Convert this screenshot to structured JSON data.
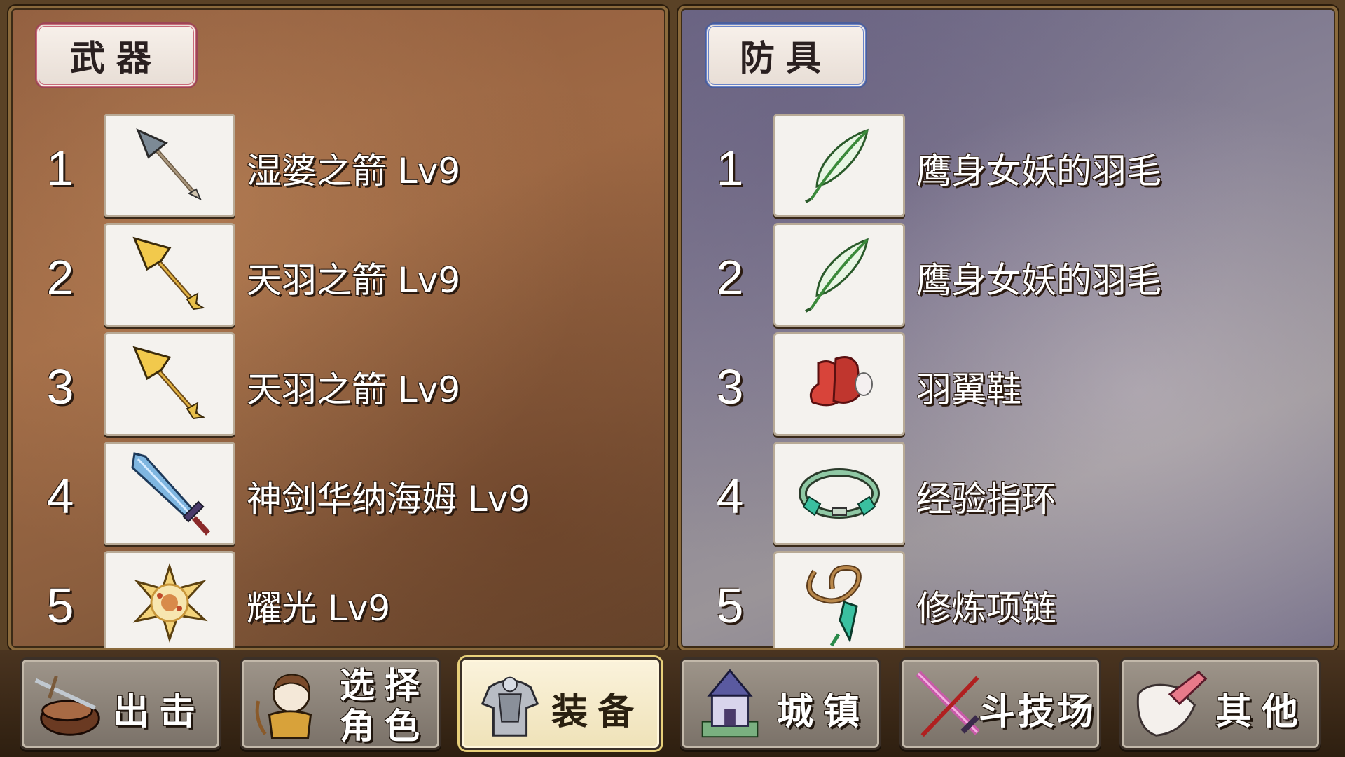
{
  "weapons": {
    "tab_label": "武器",
    "items": [
      {
        "num": "1",
        "name": "湿婆之箭 Lv9",
        "icon": "arrow-icon"
      },
      {
        "num": "2",
        "name": "天羽之箭 Lv9",
        "icon": "golden-arrow-icon"
      },
      {
        "num": "3",
        "name": "天羽之箭 Lv9",
        "icon": "golden-arrow-icon"
      },
      {
        "num": "4",
        "name": "神剑华纳海姆 Lv9",
        "icon": "sword-icon"
      },
      {
        "num": "5",
        "name": "耀光 Lv9",
        "icon": "radiant-orb-icon"
      }
    ]
  },
  "armor": {
    "tab_label": "防具",
    "items": [
      {
        "num": "1",
        "name": "鹰身女妖的羽毛",
        "icon": "feather-icon"
      },
      {
        "num": "2",
        "name": "鹰身女妖的羽毛",
        "icon": "feather-icon"
      },
      {
        "num": "3",
        "name": "羽翼鞋",
        "icon": "winged-boots-icon"
      },
      {
        "num": "4",
        "name": "经验指环",
        "icon": "ring-icon"
      },
      {
        "num": "5",
        "name": "修炼项链",
        "icon": "necklace-icon"
      }
    ]
  },
  "nav": {
    "items": [
      {
        "label": "出击",
        "icon": "war-drum-icon",
        "active": false
      },
      {
        "label_line1": "选择",
        "label_line2": "角色",
        "icon": "character-icon",
        "active": false
      },
      {
        "label": "装备",
        "icon": "armor-icon",
        "active": true
      },
      {
        "label": "城镇",
        "icon": "castle-icon",
        "active": false
      },
      {
        "label": "斗技场",
        "icon": "crossed-swords-icon",
        "active": false
      },
      {
        "label": "其他",
        "icon": "scroll-icon",
        "active": false
      }
    ]
  },
  "colors": {
    "weapon_tab_border": "#c86a7a",
    "armor_tab_border": "#6a84c8",
    "active_nav": "#efe2b8"
  }
}
